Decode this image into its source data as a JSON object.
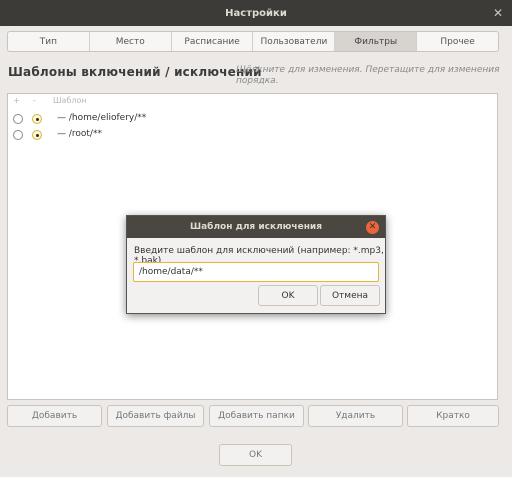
{
  "window": {
    "title": "Настройки"
  },
  "tabs": [
    {
      "label": "Тип"
    },
    {
      "label": "Место"
    },
    {
      "label": "Расписание"
    },
    {
      "label": "Пользователи"
    },
    {
      "label": "Фильтры",
      "active": true
    },
    {
      "label": "Прочее"
    }
  ],
  "section": {
    "title": "Шаблоны включений / исключений",
    "hint": "Щёлкните для изменения. Перетащите для изменения порядка."
  },
  "list": {
    "header": {
      "plus": "+",
      "minus": "-",
      "pattern": "Шаблон"
    },
    "rows": [
      {
        "pattern": "— /home/eliofery/**",
        "mode": "exclude"
      },
      {
        "pattern": "— /root/**",
        "mode": "exclude"
      }
    ]
  },
  "buttons": {
    "add": "Добавить",
    "add_files": "Добавить файлы",
    "add_folders": "Добавить папки",
    "delete": "Удалить",
    "brief": "Кратко",
    "ok": "OK"
  },
  "dialog": {
    "title": "Шаблон для исключения",
    "prompt": "Введите шаблон для исключений (например: *.mp3, *.bak)",
    "input_value": "/home/data/**",
    "ok": "OK",
    "cancel": "Отмена"
  }
}
